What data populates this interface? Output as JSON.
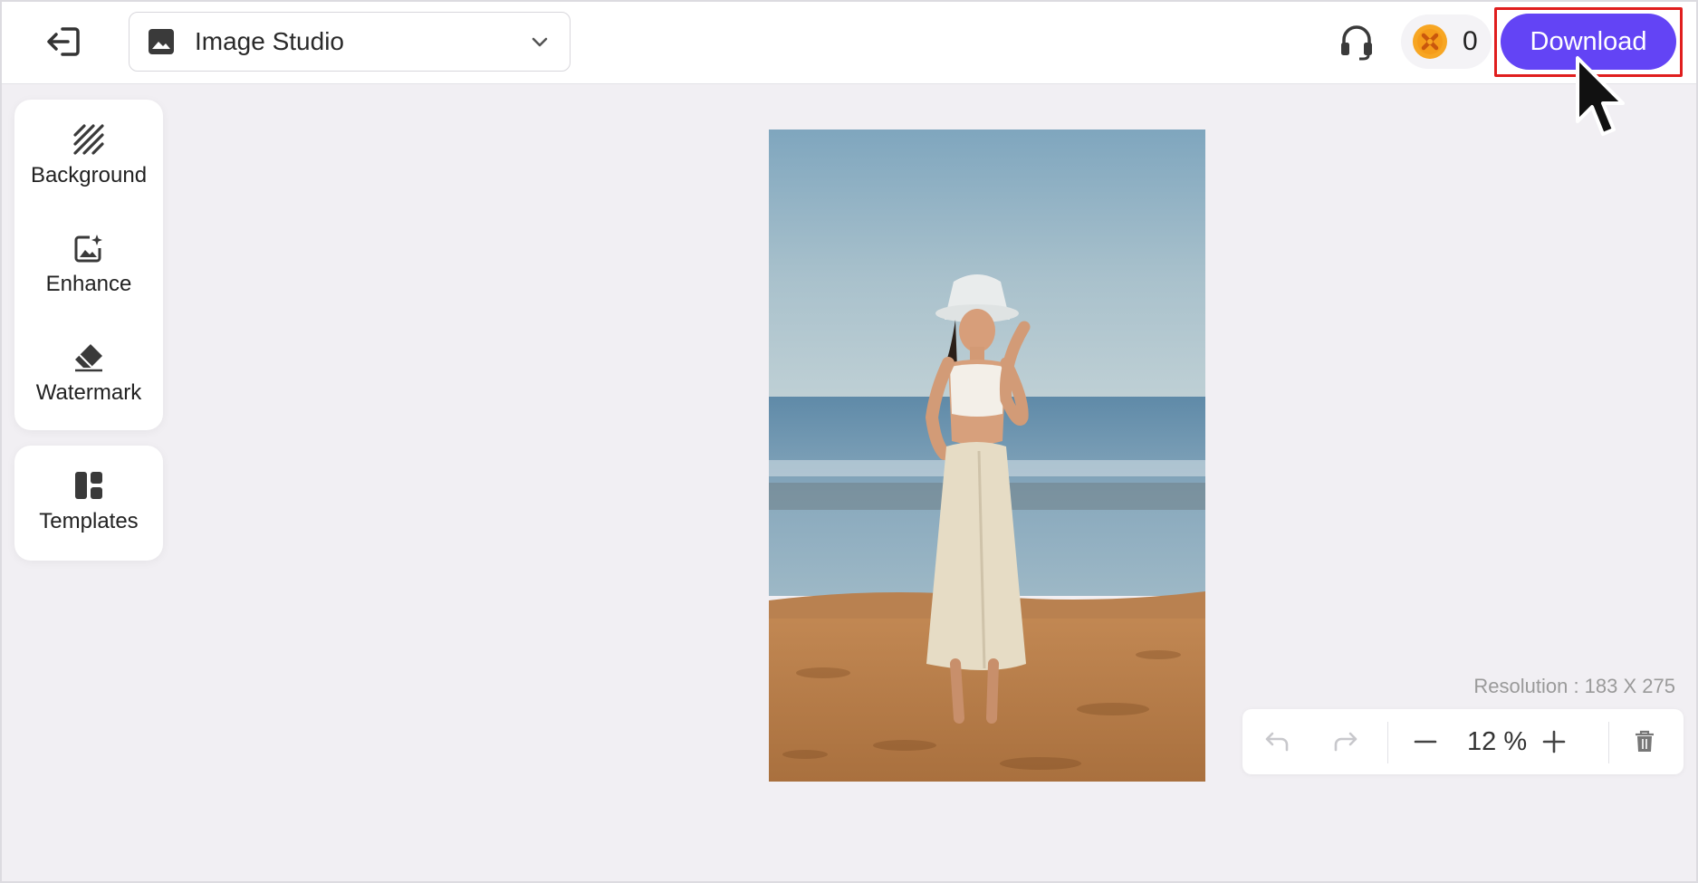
{
  "header": {
    "project_name": "Image Studio",
    "credits_count": "0",
    "download_label": "Download"
  },
  "tools": [
    {
      "label": "Background",
      "icon": "background-hatch-icon"
    },
    {
      "label": "Enhance",
      "icon": "enhance-image-icon"
    },
    {
      "label": "Watermark",
      "icon": "eraser-icon"
    }
  ],
  "templates": {
    "label": "Templates",
    "icon": "templates-icon"
  },
  "canvas": {
    "resolution_text": "Resolution : 183 X 275",
    "zoom_text": "12 %"
  },
  "colors": {
    "accent": "#6344f5",
    "highlight": "#e01e1e",
    "coin": "#f7a623",
    "background": "#f1eff3"
  }
}
